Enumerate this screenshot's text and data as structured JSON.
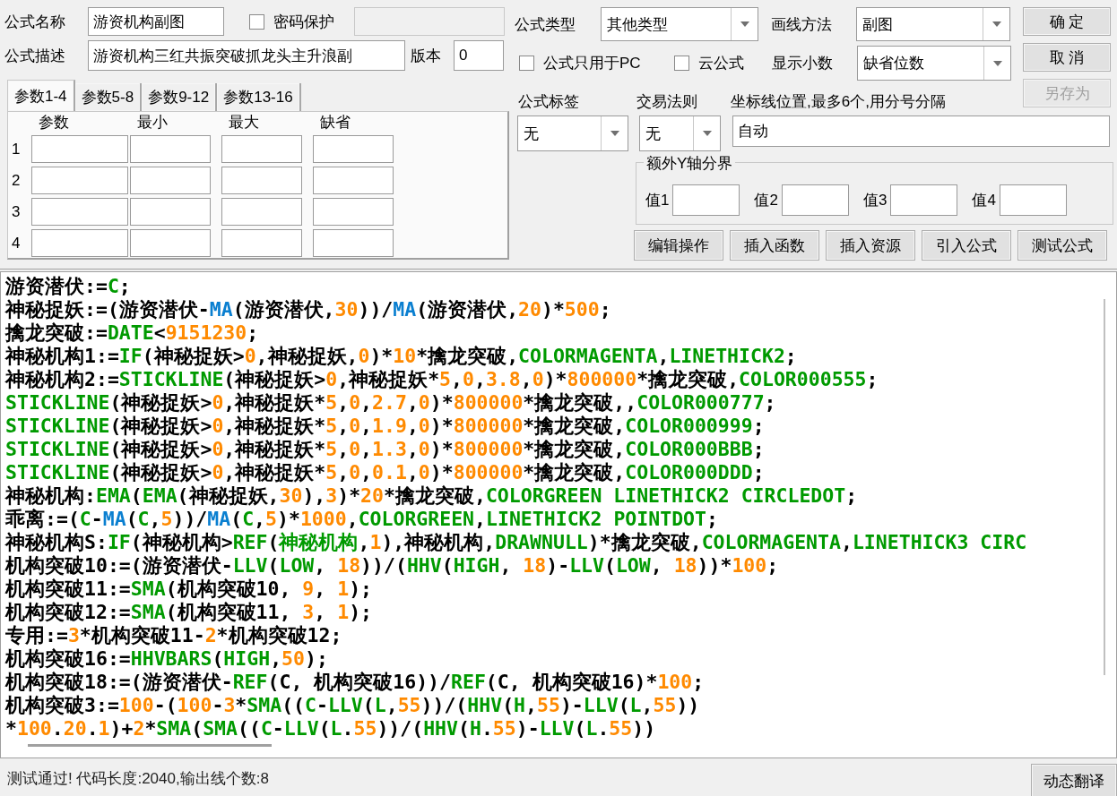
{
  "formula_name": {
    "label": "公式名称",
    "value": "游资机构副图"
  },
  "password": {
    "label": "密码保护",
    "checked": false,
    "field_disabled": true
  },
  "description": {
    "label": "公式描述",
    "value": "游资机构三红共振突破抓龙头主升浪副"
  },
  "version": {
    "label": "版本",
    "value": "0"
  },
  "param_tabs": [
    {
      "label": "参数1-4",
      "selected": true
    },
    {
      "label": "参数5-8",
      "selected": false
    },
    {
      "label": "参数9-12",
      "selected": false
    },
    {
      "label": "参数13-16",
      "selected": false
    }
  ],
  "param_columns": [
    "参数",
    "最小",
    "最大",
    "缺省"
  ],
  "param_rows": [
    "1",
    "2",
    "3",
    "4"
  ],
  "formula_type": {
    "label": "公式类型",
    "value": "其他类型"
  },
  "draw_method": {
    "label": "画线方法",
    "value": "副图"
  },
  "pc_only": {
    "label": "公式只用于PC",
    "checked": false
  },
  "cloud": {
    "label": "云公式",
    "checked": false
  },
  "decimals": {
    "label": "显示小数",
    "value": "缺省位数"
  },
  "buttons": [
    {
      "label": "确 定",
      "disabled": false
    },
    {
      "label": "取 消",
      "disabled": false
    },
    {
      "label": "另存为",
      "disabled": true
    }
  ],
  "formula_tag": {
    "label": "公式标签",
    "value": "无"
  },
  "trade_rule": {
    "label": "交易法则",
    "value": "无"
  },
  "axis_lines": {
    "label": "坐标线位置,最多6个,用分号分隔",
    "value": "自动"
  },
  "extra_y": {
    "title": "额外Y轴分界",
    "fields": [
      "值1",
      "值2",
      "值3",
      "值4"
    ]
  },
  "actions": [
    "编辑操作",
    "插入函数",
    "插入资源",
    "引入公式",
    "测试公式"
  ],
  "code_lines": [
    [
      {
        "kind": "p",
        "text": "游资潜伏:="
      },
      {
        "kind": "f",
        "text": "C"
      },
      {
        "kind": "p",
        "text": ";"
      }
    ],
    [
      {
        "kind": "p",
        "text": "神秘捉妖:=(游资潜伏-"
      },
      {
        "kind": "m",
        "text": "MA"
      },
      {
        "kind": "p",
        "text": "(游资潜伏,"
      },
      {
        "kind": "n",
        "text": "30"
      },
      {
        "kind": "p",
        "text": "))/"
      },
      {
        "kind": "m",
        "text": "MA"
      },
      {
        "kind": "p",
        "text": "(游资潜伏,"
      },
      {
        "kind": "n",
        "text": "20"
      },
      {
        "kind": "p",
        "text": ")*"
      },
      {
        "kind": "n",
        "text": "500"
      },
      {
        "kind": "p",
        "text": ";"
      }
    ],
    [
      {
        "kind": "p",
        "text": "擒龙突破:="
      },
      {
        "kind": "f",
        "text": "DATE"
      },
      {
        "kind": "p",
        "text": "<"
      },
      {
        "kind": "n",
        "text": "9151230"
      },
      {
        "kind": "p",
        "text": ";"
      }
    ],
    [
      {
        "kind": "p",
        "text": "神秘机构1:="
      },
      {
        "kind": "f",
        "text": "IF"
      },
      {
        "kind": "p",
        "text": "(神秘捉妖>"
      },
      {
        "kind": "n",
        "text": "0"
      },
      {
        "kind": "p",
        "text": ",神秘捉妖,"
      },
      {
        "kind": "n",
        "text": "0"
      },
      {
        "kind": "p",
        "text": ")*"
      },
      {
        "kind": "n",
        "text": "10"
      },
      {
        "kind": "p",
        "text": "*擒龙突破,"
      },
      {
        "kind": "f",
        "text": "COLORMAGENTA"
      },
      {
        "kind": "p",
        "text": ","
      },
      {
        "kind": "f",
        "text": "LINETHICK2"
      },
      {
        "kind": "p",
        "text": ";"
      }
    ],
    [
      {
        "kind": "p",
        "text": "神秘机构2:="
      },
      {
        "kind": "f",
        "text": "STICKLINE"
      },
      {
        "kind": "p",
        "text": "(神秘捉妖>"
      },
      {
        "kind": "n",
        "text": "0"
      },
      {
        "kind": "p",
        "text": ",神秘捉妖*"
      },
      {
        "kind": "n",
        "text": "5"
      },
      {
        "kind": "p",
        "text": ","
      },
      {
        "kind": "n",
        "text": "0"
      },
      {
        "kind": "p",
        "text": ","
      },
      {
        "kind": "n",
        "text": "3.8"
      },
      {
        "kind": "p",
        "text": ","
      },
      {
        "kind": "n",
        "text": "0"
      },
      {
        "kind": "p",
        "text": ")*"
      },
      {
        "kind": "n",
        "text": "800000"
      },
      {
        "kind": "p",
        "text": "*擒龙突破,"
      },
      {
        "kind": "f",
        "text": "COLOR000555"
      },
      {
        "kind": "p",
        "text": ";"
      }
    ],
    [
      {
        "kind": "f",
        "text": "STICKLINE"
      },
      {
        "kind": "p",
        "text": "(神秘捉妖>"
      },
      {
        "kind": "n",
        "text": "0"
      },
      {
        "kind": "p",
        "text": ",神秘捉妖*"
      },
      {
        "kind": "n",
        "text": "5"
      },
      {
        "kind": "p",
        "text": ","
      },
      {
        "kind": "n",
        "text": "0"
      },
      {
        "kind": "p",
        "text": ","
      },
      {
        "kind": "n",
        "text": "2.7"
      },
      {
        "kind": "p",
        "text": ","
      },
      {
        "kind": "n",
        "text": "0"
      },
      {
        "kind": "p",
        "text": ")*"
      },
      {
        "kind": "n",
        "text": "800000"
      },
      {
        "kind": "p",
        "text": "*擒龙突破,,"
      },
      {
        "kind": "f",
        "text": "COLOR000777"
      },
      {
        "kind": "p",
        "text": ";"
      }
    ],
    [
      {
        "kind": "f",
        "text": "STICKLINE"
      },
      {
        "kind": "p",
        "text": "(神秘捉妖>"
      },
      {
        "kind": "n",
        "text": "0"
      },
      {
        "kind": "p",
        "text": ",神秘捉妖*"
      },
      {
        "kind": "n",
        "text": "5"
      },
      {
        "kind": "p",
        "text": ","
      },
      {
        "kind": "n",
        "text": "0"
      },
      {
        "kind": "p",
        "text": ","
      },
      {
        "kind": "n",
        "text": "1.9"
      },
      {
        "kind": "p",
        "text": ","
      },
      {
        "kind": "n",
        "text": "0"
      },
      {
        "kind": "p",
        "text": ")*"
      },
      {
        "kind": "n",
        "text": "800000"
      },
      {
        "kind": "p",
        "text": "*擒龙突破,"
      },
      {
        "kind": "f",
        "text": "COLOR000999"
      },
      {
        "kind": "p",
        "text": ";"
      }
    ],
    [
      {
        "kind": "f",
        "text": "STICKLINE"
      },
      {
        "kind": "p",
        "text": "(神秘捉妖>"
      },
      {
        "kind": "n",
        "text": "0"
      },
      {
        "kind": "p",
        "text": ",神秘捉妖*"
      },
      {
        "kind": "n",
        "text": "5"
      },
      {
        "kind": "p",
        "text": ","
      },
      {
        "kind": "n",
        "text": "0"
      },
      {
        "kind": "p",
        "text": ","
      },
      {
        "kind": "n",
        "text": "1.3"
      },
      {
        "kind": "p",
        "text": ","
      },
      {
        "kind": "n",
        "text": "0"
      },
      {
        "kind": "p",
        "text": ")*"
      },
      {
        "kind": "n",
        "text": "800000"
      },
      {
        "kind": "p",
        "text": "*擒龙突破,"
      },
      {
        "kind": "f",
        "text": "COLOR000BBB"
      },
      {
        "kind": "p",
        "text": ";"
      }
    ],
    [
      {
        "kind": "f",
        "text": "STICKLINE"
      },
      {
        "kind": "p",
        "text": "(神秘捉妖>"
      },
      {
        "kind": "n",
        "text": "0"
      },
      {
        "kind": "p",
        "text": ",神秘捉妖*"
      },
      {
        "kind": "n",
        "text": "5"
      },
      {
        "kind": "p",
        "text": ","
      },
      {
        "kind": "n",
        "text": "0"
      },
      {
        "kind": "p",
        "text": ","
      },
      {
        "kind": "n",
        "text": "0.1"
      },
      {
        "kind": "p",
        "text": ","
      },
      {
        "kind": "n",
        "text": "0"
      },
      {
        "kind": "p",
        "text": ")*"
      },
      {
        "kind": "n",
        "text": "800000"
      },
      {
        "kind": "p",
        "text": "*擒龙突破,"
      },
      {
        "kind": "f",
        "text": "COLOR000DDD"
      },
      {
        "kind": "p",
        "text": ";"
      }
    ],
    [
      {
        "kind": "p",
        "text": "神秘机构:"
      },
      {
        "kind": "f",
        "text": "EMA"
      },
      {
        "kind": "p",
        "text": "("
      },
      {
        "kind": "f",
        "text": "EMA"
      },
      {
        "kind": "p",
        "text": "(神秘捉妖,"
      },
      {
        "kind": "n",
        "text": "30"
      },
      {
        "kind": "p",
        "text": "),"
      },
      {
        "kind": "n",
        "text": "3"
      },
      {
        "kind": "p",
        "text": ")*"
      },
      {
        "kind": "n",
        "text": "20"
      },
      {
        "kind": "p",
        "text": "*擒龙突破,"
      },
      {
        "kind": "f",
        "text": "COLORGREEN LINETHICK2 CIRCLEDOT"
      },
      {
        "kind": "p",
        "text": ";"
      }
    ],
    [
      {
        "kind": "p",
        "text": "乖离:=("
      },
      {
        "kind": "f",
        "text": "C"
      },
      {
        "kind": "p",
        "text": "-"
      },
      {
        "kind": "m",
        "text": "MA"
      },
      {
        "kind": "p",
        "text": "("
      },
      {
        "kind": "f",
        "text": "C"
      },
      {
        "kind": "p",
        "text": ","
      },
      {
        "kind": "n",
        "text": "5"
      },
      {
        "kind": "p",
        "text": "))/"
      },
      {
        "kind": "m",
        "text": "MA"
      },
      {
        "kind": "p",
        "text": "("
      },
      {
        "kind": "f",
        "text": "C"
      },
      {
        "kind": "p",
        "text": ","
      },
      {
        "kind": "n",
        "text": "5"
      },
      {
        "kind": "p",
        "text": ")*"
      },
      {
        "kind": "n",
        "text": "1000"
      },
      {
        "kind": "p",
        "text": ","
      },
      {
        "kind": "f",
        "text": "COLORGREEN"
      },
      {
        "kind": "p",
        "text": ","
      },
      {
        "kind": "f",
        "text": "LINETHICK2 POINTDOT"
      },
      {
        "kind": "p",
        "text": ";"
      }
    ],
    [
      {
        "kind": "p",
        "text": "神秘机构S:"
      },
      {
        "kind": "f",
        "text": "IF"
      },
      {
        "kind": "p",
        "text": "(神秘机构>"
      },
      {
        "kind": "f",
        "text": "REF"
      },
      {
        "kind": "p",
        "text": "("
      },
      {
        "kind": "f",
        "text": "神秘机构"
      },
      {
        "kind": "p",
        "text": ","
      },
      {
        "kind": "n",
        "text": "1"
      },
      {
        "kind": "p",
        "text": "),神秘机构,"
      },
      {
        "kind": "f",
        "text": "DRAWNULL"
      },
      {
        "kind": "p",
        "text": ")*擒龙突破,"
      },
      {
        "kind": "f",
        "text": "COLORMAGENTA"
      },
      {
        "kind": "p",
        "text": ","
      },
      {
        "kind": "f",
        "text": "LINETHICK3 CIRC"
      }
    ],
    [
      {
        "kind": "p",
        "text": "机构突破10:=(游资潜伏-"
      },
      {
        "kind": "f",
        "text": "LLV"
      },
      {
        "kind": "p",
        "text": "("
      },
      {
        "kind": "f",
        "text": "LOW"
      },
      {
        "kind": "p",
        "text": ", "
      },
      {
        "kind": "n",
        "text": "18"
      },
      {
        "kind": "p",
        "text": "))/("
      },
      {
        "kind": "f",
        "text": "HHV"
      },
      {
        "kind": "p",
        "text": "("
      },
      {
        "kind": "f",
        "text": "HIGH"
      },
      {
        "kind": "p",
        "text": ", "
      },
      {
        "kind": "n",
        "text": "18"
      },
      {
        "kind": "p",
        "text": ")-"
      },
      {
        "kind": "f",
        "text": "LLV"
      },
      {
        "kind": "p",
        "text": "("
      },
      {
        "kind": "f",
        "text": "LOW"
      },
      {
        "kind": "p",
        "text": ", "
      },
      {
        "kind": "n",
        "text": "18"
      },
      {
        "kind": "p",
        "text": "))*"
      },
      {
        "kind": "n",
        "text": "100"
      },
      {
        "kind": "p",
        "text": ";"
      }
    ],
    [
      {
        "kind": "p",
        "text": "机构突破11:="
      },
      {
        "kind": "f",
        "text": "SMA"
      },
      {
        "kind": "p",
        "text": "(机构突破10, "
      },
      {
        "kind": "n",
        "text": "9"
      },
      {
        "kind": "p",
        "text": ", "
      },
      {
        "kind": "n",
        "text": "1"
      },
      {
        "kind": "p",
        "text": ");"
      }
    ],
    [
      {
        "kind": "p",
        "text": "机构突破12:="
      },
      {
        "kind": "f",
        "text": "SMA"
      },
      {
        "kind": "p",
        "text": "(机构突破11, "
      },
      {
        "kind": "n",
        "text": "3"
      },
      {
        "kind": "p",
        "text": ", "
      },
      {
        "kind": "n",
        "text": "1"
      },
      {
        "kind": "p",
        "text": ");"
      }
    ],
    [
      {
        "kind": "p",
        "text": "专用:="
      },
      {
        "kind": "n",
        "text": "3"
      },
      {
        "kind": "p",
        "text": "*机构突破11-"
      },
      {
        "kind": "n",
        "text": "2"
      },
      {
        "kind": "p",
        "text": "*机构突破12;"
      }
    ],
    [
      {
        "kind": "p",
        "text": "机构突破16:="
      },
      {
        "kind": "f",
        "text": "HHVBARS"
      },
      {
        "kind": "p",
        "text": "("
      },
      {
        "kind": "f",
        "text": "HIGH"
      },
      {
        "kind": "p",
        "text": ","
      },
      {
        "kind": "n",
        "text": "50"
      },
      {
        "kind": "p",
        "text": ");"
      }
    ],
    [
      {
        "kind": "p",
        "text": "机构突破18:=(游资潜伏-"
      },
      {
        "kind": "f",
        "text": "REF"
      },
      {
        "kind": "p",
        "text": "(C, 机构突破16))/"
      },
      {
        "kind": "f",
        "text": "REF"
      },
      {
        "kind": "p",
        "text": "(C, 机构突破16)*"
      },
      {
        "kind": "n",
        "text": "100"
      },
      {
        "kind": "p",
        "text": ";"
      }
    ],
    [
      {
        "kind": "p",
        "text": "机构突破3:="
      },
      {
        "kind": "n",
        "text": "100"
      },
      {
        "kind": "p",
        "text": "-("
      },
      {
        "kind": "n",
        "text": "100"
      },
      {
        "kind": "p",
        "text": "-"
      },
      {
        "kind": "n",
        "text": "3"
      },
      {
        "kind": "p",
        "text": "*"
      },
      {
        "kind": "f",
        "text": "SMA"
      },
      {
        "kind": "p",
        "text": "(("
      },
      {
        "kind": "f",
        "text": "C"
      },
      {
        "kind": "p",
        "text": "-"
      },
      {
        "kind": "f",
        "text": "LLV"
      },
      {
        "kind": "p",
        "text": "("
      },
      {
        "kind": "f",
        "text": "L"
      },
      {
        "kind": "p",
        "text": ","
      },
      {
        "kind": "n",
        "text": "55"
      },
      {
        "kind": "p",
        "text": "))/("
      },
      {
        "kind": "f",
        "text": "HHV"
      },
      {
        "kind": "p",
        "text": "("
      },
      {
        "kind": "f",
        "text": "H"
      },
      {
        "kind": "p",
        "text": ","
      },
      {
        "kind": "n",
        "text": "55"
      },
      {
        "kind": "p",
        "text": ")-"
      },
      {
        "kind": "f",
        "text": "LLV"
      },
      {
        "kind": "p",
        "text": "("
      },
      {
        "kind": "f",
        "text": "L"
      },
      {
        "kind": "p",
        "text": ","
      },
      {
        "kind": "n",
        "text": "55"
      },
      {
        "kind": "p",
        "text": "))"
      }
    ],
    [
      {
        "kind": "p",
        "text": "*"
      },
      {
        "kind": "n",
        "text": "100"
      },
      {
        "kind": "p",
        "text": "."
      },
      {
        "kind": "n",
        "text": "20"
      },
      {
        "kind": "p",
        "text": "."
      },
      {
        "kind": "n",
        "text": "1"
      },
      {
        "kind": "p",
        "text": ")+"
      },
      {
        "kind": "n",
        "text": "2"
      },
      {
        "kind": "p",
        "text": "*"
      },
      {
        "kind": "f",
        "text": "SMA"
      },
      {
        "kind": "p",
        "text": "("
      },
      {
        "kind": "f",
        "text": "SMA"
      },
      {
        "kind": "p",
        "text": "(("
      },
      {
        "kind": "f",
        "text": "C"
      },
      {
        "kind": "p",
        "text": "-"
      },
      {
        "kind": "f",
        "text": "LLV"
      },
      {
        "kind": "p",
        "text": "("
      },
      {
        "kind": "f",
        "text": "L"
      },
      {
        "kind": "p",
        "text": "."
      },
      {
        "kind": "n",
        "text": "55"
      },
      {
        "kind": "p",
        "text": "))/("
      },
      {
        "kind": "f",
        "text": "HHV"
      },
      {
        "kind": "p",
        "text": "("
      },
      {
        "kind": "f",
        "text": "H"
      },
      {
        "kind": "p",
        "text": "."
      },
      {
        "kind": "n",
        "text": "55"
      },
      {
        "kind": "p",
        "text": ")-"
      },
      {
        "kind": "f",
        "text": "LLV"
      },
      {
        "kind": "p",
        "text": "("
      },
      {
        "kind": "f",
        "text": "L"
      },
      {
        "kind": "p",
        "text": "."
      },
      {
        "kind": "n",
        "text": "55"
      },
      {
        "kind": "p",
        "text": "))"
      }
    ]
  ],
  "status": "测试通过! 代码长度:2040,输出线个数:8",
  "translate_button": "动态翻译"
}
